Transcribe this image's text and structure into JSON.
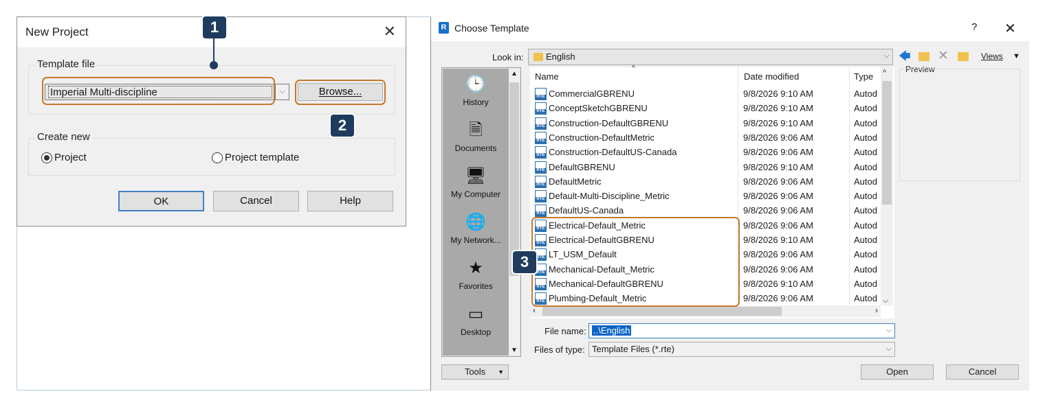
{
  "new_project": {
    "title": "New Project",
    "close_glyph": "✕",
    "template_group_label": "Template file",
    "template_value": "Imperial Multi-discipline",
    "combo_arrow": "⌵",
    "browse_label": "Browse...",
    "create_group_label": "Create new",
    "radio_project": "Project",
    "radio_project_template": "Project template",
    "selected_option": "Project",
    "ok_label": "OK",
    "cancel_label": "Cancel",
    "help_label": "Help"
  },
  "callouts": {
    "one": "1",
    "two": "2",
    "three": "3",
    "color": "#1f3c5e",
    "highlight_color": "#c6782c"
  },
  "choose_template": {
    "title": "Choose Template",
    "logo_letter": "R",
    "help_glyph": "?",
    "close_glyph": "✕",
    "look_in_label": "Look in:",
    "look_in_value": "English",
    "views_label": "Views",
    "toolbar_icons": [
      "back-arrow-icon",
      "up-folder-icon",
      "delete-icon",
      "new-folder-icon",
      "views-dropdown-icon"
    ],
    "preview_label": "Preview",
    "places": [
      {
        "label": "History",
        "icon": "history-icon"
      },
      {
        "label": "Documents",
        "icon": "documents-icon"
      },
      {
        "label": "My Computer",
        "icon": "computer-icon"
      },
      {
        "label": "My Network...",
        "icon": "network-icon"
      },
      {
        "label": "Favorites",
        "icon": "favorites-icon"
      },
      {
        "label": "Desktop",
        "icon": "desktop-icon"
      }
    ],
    "columns": {
      "name": "Name",
      "date": "Date modified",
      "type": "Type"
    },
    "files": [
      {
        "name": "CommercialGBRENU",
        "date": "9/8/2026 9:10 AM",
        "type": "Autod"
      },
      {
        "name": "ConceptSketchGBRENU",
        "date": "9/8/2026 9:10 AM",
        "type": "Autod"
      },
      {
        "name": "Construction-DefaultGBRENU",
        "date": "9/8/2026 9:10 AM",
        "type": "Autod"
      },
      {
        "name": "Construction-DefaultMetric",
        "date": "9/8/2026 9:06 AM",
        "type": "Autod"
      },
      {
        "name": "Construction-DefaultUS-Canada",
        "date": "9/8/2026 9:06 AM",
        "type": "Autod"
      },
      {
        "name": "DefaultGBRENU",
        "date": "9/8/2026 9:10 AM",
        "type": "Autod"
      },
      {
        "name": "DefaultMetric",
        "date": "9/8/2026 9:06 AM",
        "type": "Autod"
      },
      {
        "name": "Default-Multi-Discipline_Metric",
        "date": "9/8/2026 9:06 AM",
        "type": "Autod"
      },
      {
        "name": "DefaultUS-Canada",
        "date": "9/8/2026 9:06 AM",
        "type": "Autod"
      },
      {
        "name": "Electrical-Default_Metric",
        "date": "9/8/2026 9:06 AM",
        "type": "Autod"
      },
      {
        "name": "Electrical-DefaultGBRENU",
        "date": "9/8/2026 9:10 AM",
        "type": "Autod"
      },
      {
        "name": "LT_USM_Default",
        "date": "9/8/2026 9:06 AM",
        "type": "Autod"
      },
      {
        "name": "Mechanical-Default_Metric",
        "date": "9/8/2026 9:06 AM",
        "type": "Autod"
      },
      {
        "name": "Mechanical-DefaultGBRENU",
        "date": "9/8/2026 9:10 AM",
        "type": "Autod"
      },
      {
        "name": "Plumbing-Default_Metric",
        "date": "9/8/2026 9:06 AM",
        "type": "Autod"
      }
    ],
    "file_name_label": "File name:",
    "file_name_value": "..\\English",
    "files_of_type_label": "Files of type:",
    "files_of_type_value": "Template Files (*.rte)",
    "tools_label": "Tools",
    "open_label": "Open",
    "cancel_label": "Cancel"
  }
}
